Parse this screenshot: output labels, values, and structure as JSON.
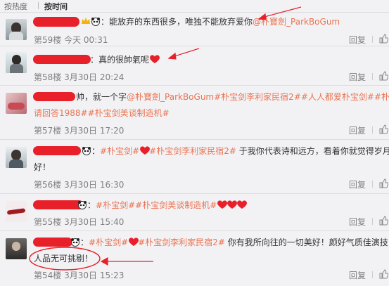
{
  "tabs": {
    "hot": "按热度",
    "time": "按时间"
  },
  "comments": [
    {
      "text": "：能放弃的东西很多，唯独不能放弃爱你",
      "mention": "@朴寶劍_ParkBoGum",
      "floor": "第59楼",
      "time": "今天 00:31",
      "reply": "回复"
    },
    {
      "text": "：真的很帥氣呢",
      "floor": "第58楼",
      "time": "3月30日 20:24",
      "reply": "回复"
    },
    {
      "text_a": "帅，就一个字",
      "mention": "@朴寶劍_ParkBoGum",
      "topics": [
        "#朴宝剑李利家民宿2#",
        "#人人都爱朴宝剑#",
        "#朴宝"
      ],
      "line2_topics": [
        "请回答1988#",
        "#朴宝剑美谈制造机#"
      ],
      "floor": "第57楼",
      "time": "3月30日 17:20",
      "reply": "回复"
    },
    {
      "topic1": "#朴宝剑#",
      "topic2": "#朴宝剑李利家民宿2#",
      "text": "于我你代表诗和远方，看着你就觉得岁月",
      "text2": "好！",
      "floor": "第56楼",
      "time": "3月30日 16:30",
      "reply": "回复"
    },
    {
      "topic1": "#朴宝剑#",
      "topic2": "#朴宝剑美谈制造机#",
      "floor": "第55楼",
      "time": "3月30日 15:40",
      "reply": "回复"
    },
    {
      "topic1": "#朴宝剑#",
      "topic2": "#朴宝剑李利家民宿2#",
      "text": "你有我所向往的一切美好！颜好气质佳演技",
      "text2": "人品无可挑剔！",
      "floor": "第54楼",
      "time": "3月30日 15:23",
      "reply": "回复"
    }
  ],
  "colors": {
    "accent": "#eb7350",
    "redact": "#e8202a",
    "heart": "#e8202a"
  }
}
